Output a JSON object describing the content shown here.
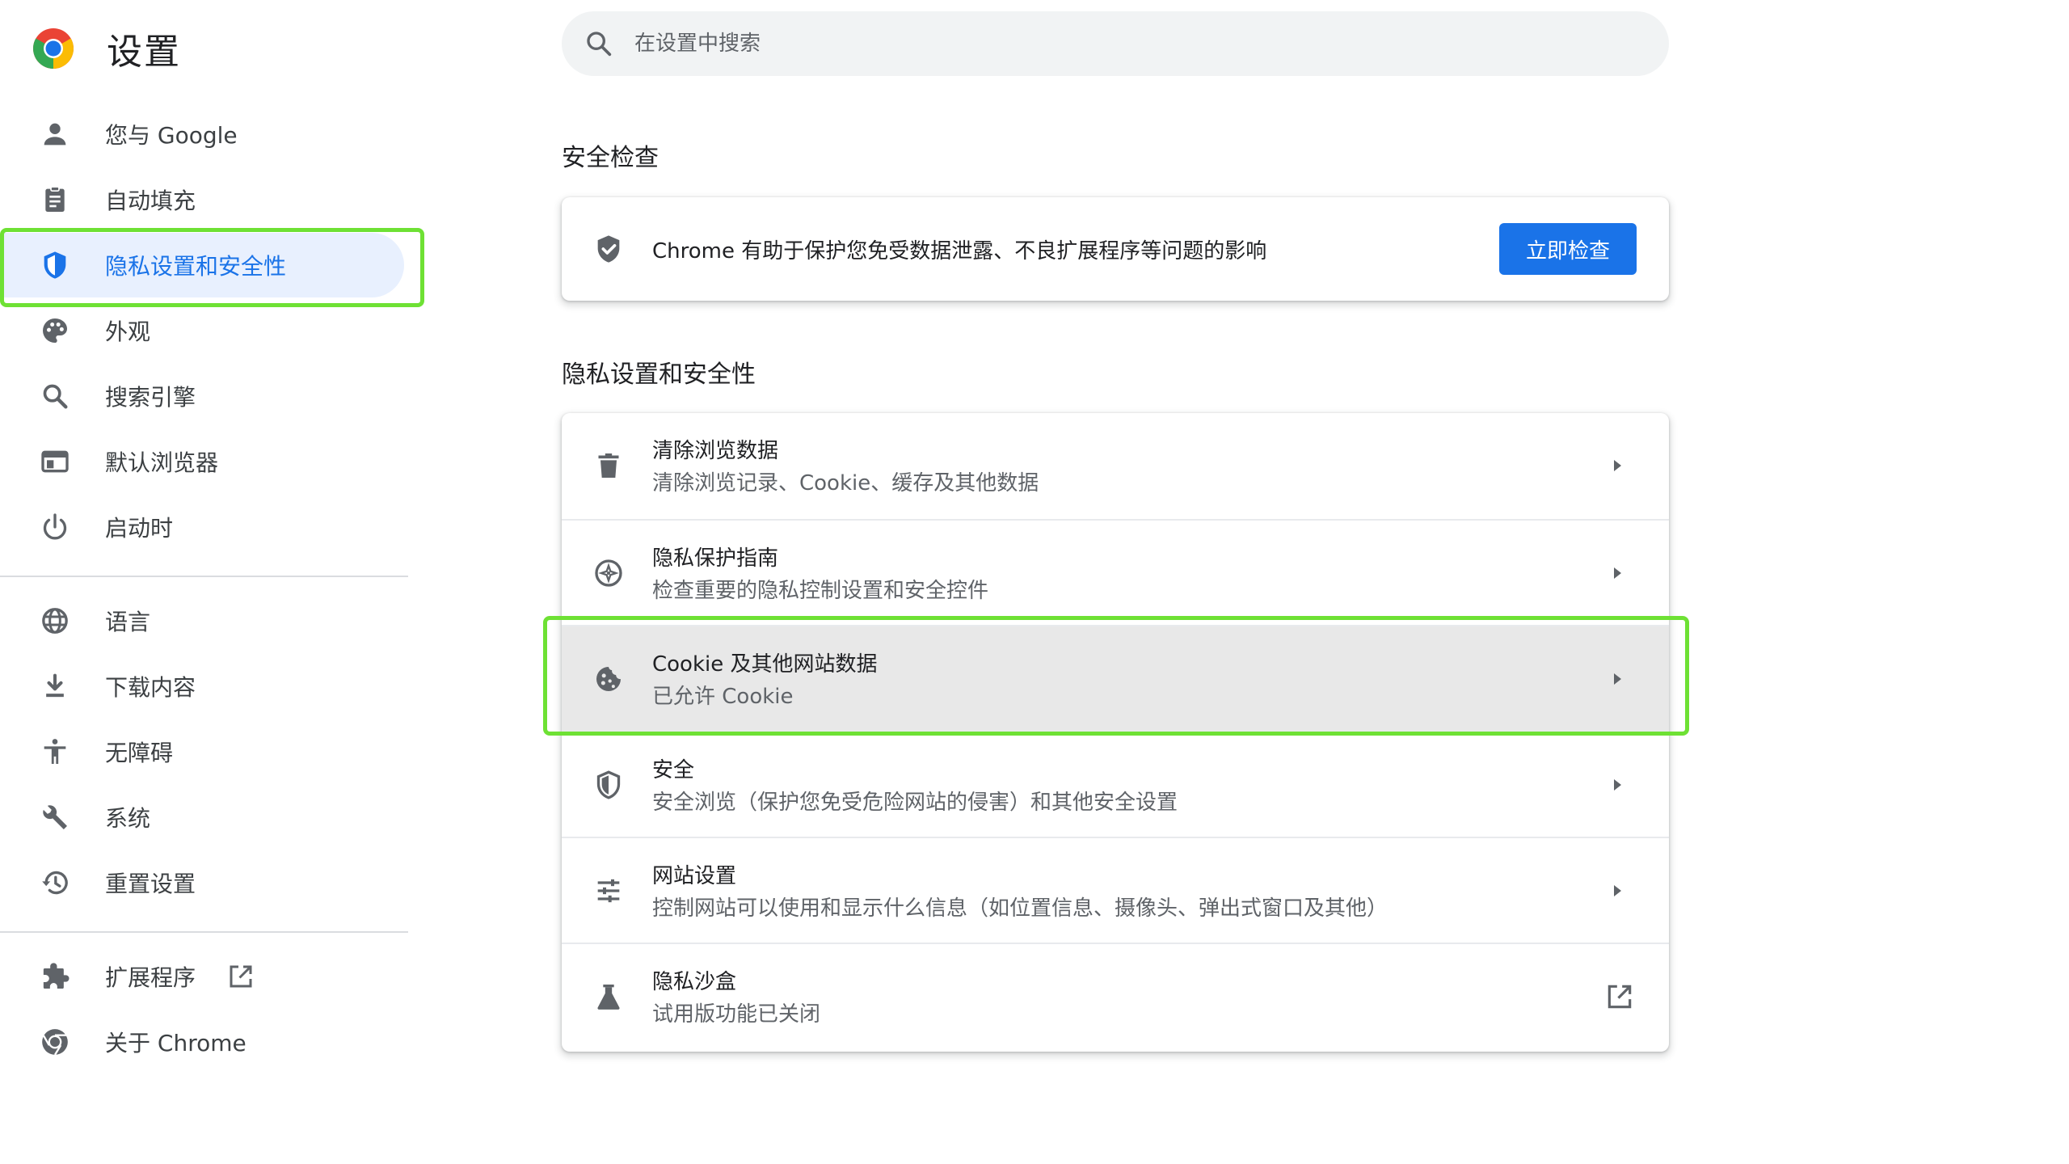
{
  "brand": {
    "title": "设置"
  },
  "sidebar": {
    "items": [
      {
        "label": "您与 Google",
        "icon": "person-icon"
      },
      {
        "label": "自动填充",
        "icon": "clipboard-icon"
      },
      {
        "label": "隐私设置和安全性",
        "icon": "shield-icon",
        "active": true
      },
      {
        "label": "外观",
        "icon": "palette-icon"
      },
      {
        "label": "搜索引擎",
        "icon": "search-icon"
      },
      {
        "label": "默认浏览器",
        "icon": "browser-window-icon"
      },
      {
        "label": "启动时",
        "icon": "power-icon"
      },
      {
        "label": "语言",
        "icon": "globe-icon"
      },
      {
        "label": "下载内容",
        "icon": "download-icon"
      },
      {
        "label": "无障碍",
        "icon": "accessibility-icon"
      },
      {
        "label": "系统",
        "icon": "wrench-icon"
      },
      {
        "label": "重置设置",
        "icon": "history-icon"
      },
      {
        "label": "扩展程序",
        "icon": "puzzle-icon"
      },
      {
        "label": "关于 Chrome",
        "icon": "chrome-icon"
      }
    ]
  },
  "search": {
    "placeholder": "在设置中搜索"
  },
  "safety_check": {
    "heading": "安全检查",
    "text": "Chrome 有助于保护您免受数据泄露、不良扩展程序等问题的影响",
    "button": "立即检查"
  },
  "privacy": {
    "heading": "隐私设置和安全性",
    "rows": [
      {
        "title": "清除浏览数据",
        "subtitle": "清除浏览记录、Cookie、缓存及其他数据",
        "icon": "trash-icon"
      },
      {
        "title": "隐私保护指南",
        "subtitle": "检查重要的隐私控制设置和安全控件",
        "icon": "compass-icon"
      },
      {
        "title": "Cookie 及其他网站数据",
        "subtitle": "已允许 Cookie",
        "icon": "cookie-icon"
      },
      {
        "title": "安全",
        "subtitle": "安全浏览（保护您免受危险网站的侵害）和其他安全设置",
        "icon": "security-shield-icon"
      },
      {
        "title": "网站设置",
        "subtitle": "控制网站可以使用和显示什么信息（如位置信息、摄像头、弹出式窗口及其他）",
        "icon": "tune-icon"
      },
      {
        "title": "隐私沙盒",
        "subtitle": "试用版功能已关闭",
        "icon": "flask-icon"
      }
    ]
  },
  "colors": {
    "accent": "#1a73e8",
    "active_bg": "#e8f0fe",
    "highlight_outline": "#6ee134",
    "text_secondary": "#5f6368"
  }
}
